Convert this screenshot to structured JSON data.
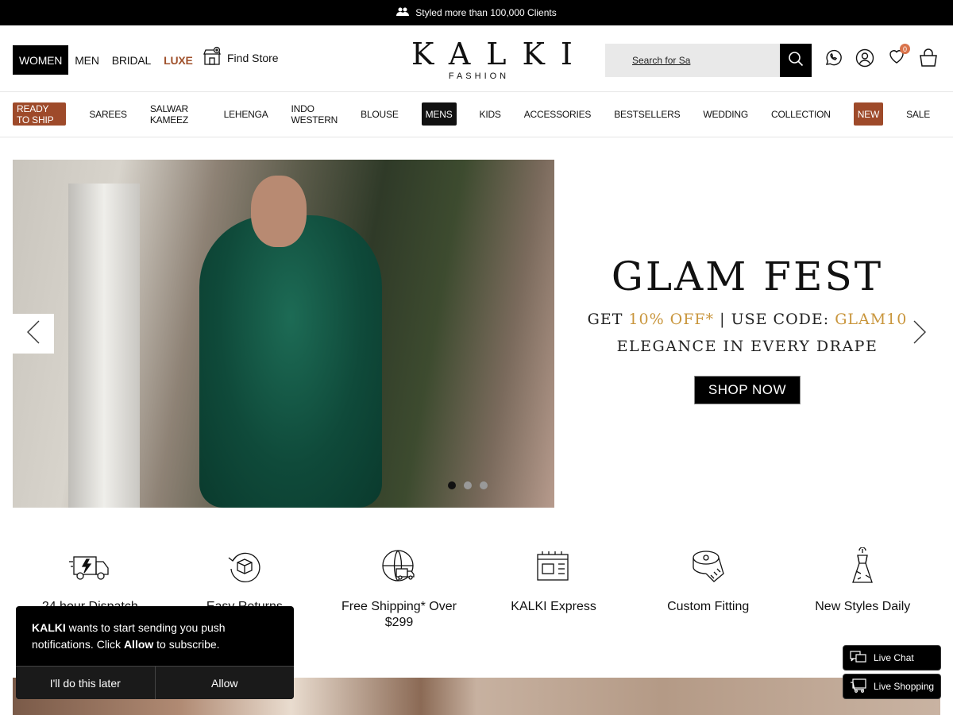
{
  "topbar": {
    "text": "Styled more than 100,000 Clients",
    "icon": "users-icon"
  },
  "header": {
    "gender_tabs": [
      "WOMEN",
      "MEN",
      "BRIDAL",
      "LUXE"
    ],
    "find_store": "Find Store",
    "logo": {
      "name": "KALKI",
      "sub": "FASHION"
    },
    "search": {
      "placeholder": "Search for Sa"
    },
    "wishlist_count": "0"
  },
  "nav": {
    "items": [
      "READY TO SHIP",
      "SAREES",
      "SALWAR KAMEEZ",
      "LEHENGA",
      "INDO WESTERN",
      "BLOUSE",
      "MENS",
      "KIDS",
      "ACCESSORIES",
      "BESTSELLERS",
      "WEDDING",
      "COLLECTION",
      "NEW",
      "SALE"
    ]
  },
  "hero": {
    "title": "GLAM FEST",
    "offer_prefix": "GET ",
    "offer_discount": "10% OFF*",
    "offer_mid": " | USE CODE: ",
    "offer_code": "GLAM10",
    "tagline": "ELEGANCE IN EVERY DRAPE",
    "cta": "SHOP NOW",
    "slide_count": 3,
    "active_slide": 1
  },
  "features": [
    {
      "label": "24 hour Dispatch",
      "icon": "truck-lightning-icon"
    },
    {
      "label": "Easy Returns",
      "icon": "return-box-icon"
    },
    {
      "label": "Free Shipping* Over $299",
      "icon": "globe-truck-icon"
    },
    {
      "label": "KALKI Express",
      "icon": "sewing-machine-icon"
    },
    {
      "label": "Custom Fitting",
      "icon": "measuring-tape-icon"
    },
    {
      "label": "New Styles Daily",
      "icon": "dress-hanger-icon"
    }
  ],
  "push_prompt": {
    "brand": "KALKI",
    "msg1": " wants to start sending you push notifications. Click ",
    "allow_word": "Allow",
    "msg2": " to subscribe.",
    "later": "I'll do this later",
    "allow": "Allow"
  },
  "live": {
    "chat": "Live Chat",
    "shopping": "Live Shopping"
  },
  "colors": {
    "accent_brown": "#9e4a2a",
    "gold": "#c9963d",
    "black": "#000000"
  }
}
